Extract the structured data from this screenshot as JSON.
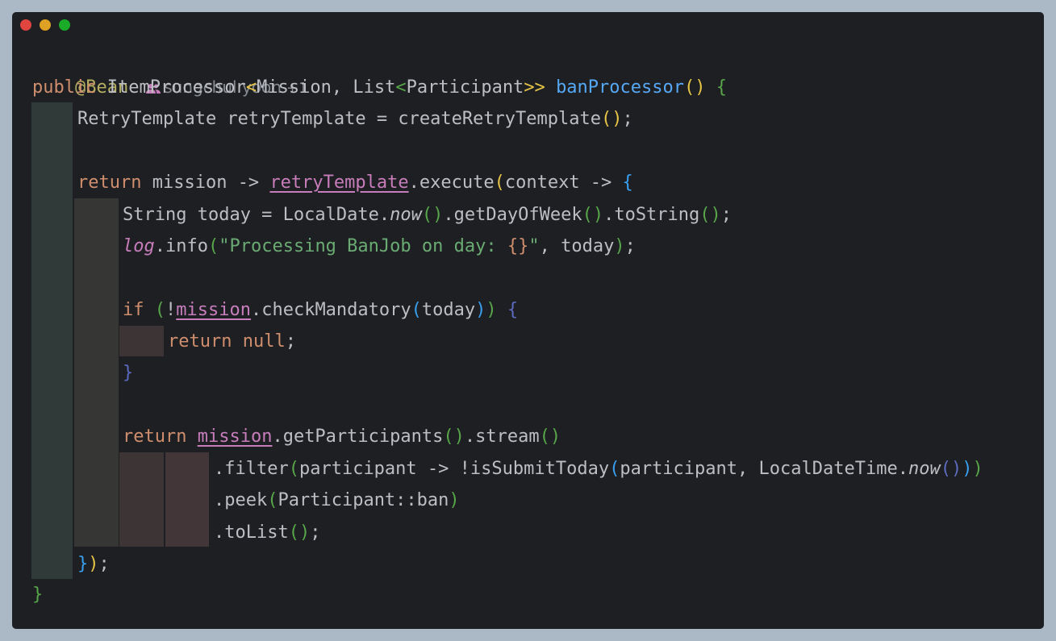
{
  "window": {
    "controls": {
      "close_color": "#e0443e",
      "minimize_color": "#dea123",
      "maximize_color": "#1aab29"
    }
  },
  "author_hint": {
    "icon": "people-icon",
    "name": "sungchul yoon",
    "extra": "+1"
  },
  "code": {
    "l1": {
      "annotation": "@Bean"
    },
    "l2": {
      "t1": "public",
      "t2": " ItemProcessor",
      "t3": "<",
      "t4": "Mission, List",
      "t5": "<",
      "t6": "Participant",
      "t7": ">>",
      "t8": " ",
      "t9": "banProcessor",
      "t10": "()",
      "t11": " ",
      "t12": "{"
    },
    "l3": {
      "t1": "RetryTemplate retryTemplate = createRetryTemplate",
      "t2": "()",
      "t3": ";"
    },
    "l5": {
      "t1": "return",
      "t2": " mission -> ",
      "t3": "retryTemplate",
      "t4": ".execute",
      "t5": "(",
      "t6": "context -> ",
      "t7": "{"
    },
    "l6": {
      "t1": "String today = LocalDate.",
      "t2": "now",
      "t3": "()",
      "t4": ".getDayOfWeek",
      "t5": "()",
      "t6": ".toString",
      "t7": "()",
      "t8": ";"
    },
    "l7": {
      "t1": "log",
      "t2": ".info",
      "t3": "(",
      "t4": "\"Processing BanJob on day: ",
      "t5": "{}",
      "t6": "\"",
      "t7": ", today",
      "t8": ")",
      "t9": ";"
    },
    "l9": {
      "t1": "if",
      "t2": " ",
      "t3": "(",
      "t4": "!",
      "t5": "mission",
      "t6": ".checkMandatory",
      "t7": "(",
      "t8": "today",
      "t9": ")",
      "t10": ")",
      "t11": " ",
      "t12": "{"
    },
    "l10": {
      "t1": "return",
      "t2": " ",
      "t3": "null",
      "t4": ";"
    },
    "l11": {
      "t1": "}"
    },
    "l13": {
      "t1": "return",
      "t2": " ",
      "t3": "mission",
      "t4": ".getParticipants",
      "t5": "()",
      "t6": ".stream",
      "t7": "()"
    },
    "l14": {
      "t1": ".filter",
      "t2": "(",
      "t3": "participant -> !isSubmitToday",
      "t4": "(",
      "t5": "participant, LocalDateTime.",
      "t6": "now",
      "t7": "()",
      "t8": ")",
      "t9": ")"
    },
    "l15": {
      "t1": ".peek",
      "t2": "(",
      "t3": "Participant::ban",
      "t4": ")"
    },
    "l16": {
      "t1": ".toList",
      "t2": "()",
      "t3": ";"
    },
    "l17": {
      "t1": "}",
      "t2": ")",
      "t3": ";"
    },
    "l18": {
      "t1": "}"
    }
  }
}
